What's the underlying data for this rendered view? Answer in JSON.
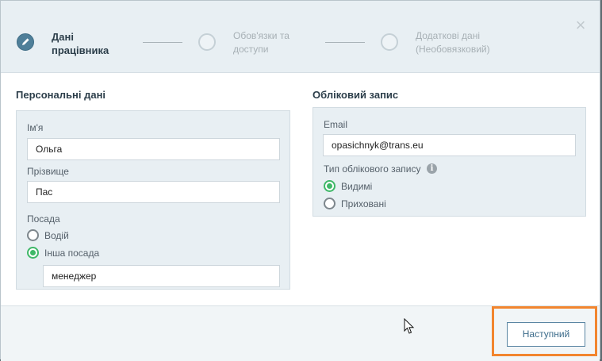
{
  "stepper": {
    "steps": [
      {
        "line1": "Дані",
        "line2": "працівника"
      },
      {
        "line1": "Обов'язки та",
        "line2": "доступи"
      },
      {
        "line1": "Додаткові дані",
        "line2": "(Необовязковий)"
      }
    ],
    "active_step": 1,
    "close_label": "×"
  },
  "personal": {
    "title": "Персональні дані",
    "first_name_label": "Ім'я",
    "first_name_value": "Ольга",
    "last_name_label": "Прізвище",
    "last_name_value": "Пас",
    "position_label": "Посада",
    "position_options": [
      "Водій",
      "Інша посада"
    ],
    "position_selected": "Інша посада",
    "other_position_value": "менеджер"
  },
  "account": {
    "title": "Обліковий запис",
    "email_label": "Email",
    "email_value": "opasichnyk@trans.eu",
    "type_label": "Тип облікового запису",
    "type_options": [
      "Видимі",
      "Приховані"
    ],
    "type_selected": "Видимі"
  },
  "footer": {
    "next_label": "Наступний"
  },
  "colors": {
    "accent": "#4f7f99",
    "radio_checked": "#3fb868",
    "highlight": "#f2852e"
  }
}
